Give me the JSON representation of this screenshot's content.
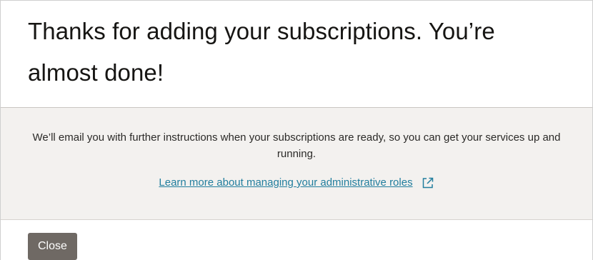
{
  "dialog": {
    "title": "Thanks for adding your subscriptions. You’re almost done!",
    "message": "We’ll email you with further instructions when your subscriptions are ready, so you can get your services up and running.",
    "learn_more_link": "Learn more about managing your administrative roles",
    "learn_more_icon": "external-link-icon",
    "close_label": "Close"
  },
  "colors": {
    "title_text": "#161513",
    "body_background": "#f3f1ef",
    "link": "#227e9e",
    "close_button": "#6f6964"
  }
}
